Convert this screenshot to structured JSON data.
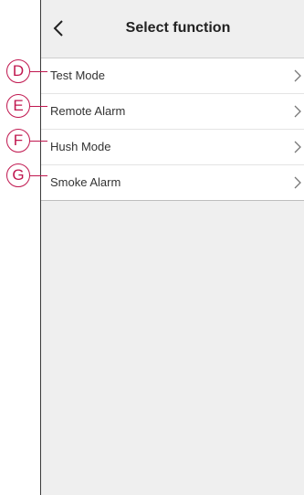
{
  "header": {
    "title": "Select function",
    "back_icon": "chevron-left-icon"
  },
  "functions": [
    {
      "callout": "D",
      "label": "Test Mode"
    },
    {
      "callout": "E",
      "label": "Remote Alarm"
    },
    {
      "callout": "F",
      "label": "Hush Mode"
    },
    {
      "callout": "G",
      "label": "Smoke Alarm"
    }
  ],
  "colors": {
    "callout": "#c0174f",
    "background": "#efefef",
    "list_background": "#ffffff"
  }
}
